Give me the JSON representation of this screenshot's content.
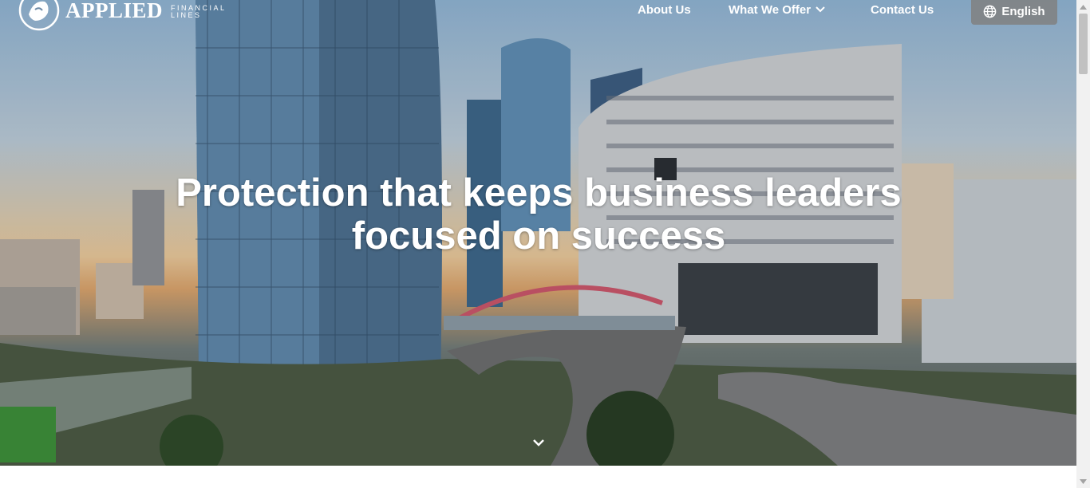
{
  "brand": {
    "name": "APPLIED",
    "subline1": "FINANCIAL",
    "subline2": "LINES"
  },
  "nav": {
    "about": "About Us",
    "offer": "What We Offer",
    "contact": "Contact Us",
    "language": "English"
  },
  "hero": {
    "line1": "Protection that keeps business leaders",
    "line2": "focused on success"
  },
  "icons": {
    "logo": "lion-emblem-icon",
    "offer_dropdown": "chevron-down-icon",
    "language": "globe-icon",
    "scroll": "chevron-down-icon"
  },
  "colors": {
    "text": "#ffffff",
    "language_button_bg": "#808080",
    "scrollbar_thumb": "#c1c1c1"
  }
}
